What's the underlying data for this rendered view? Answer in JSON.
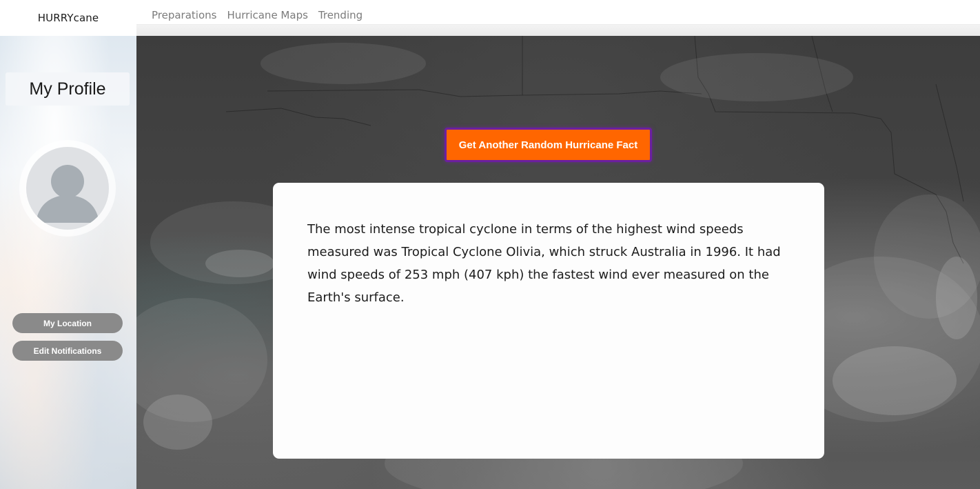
{
  "brand": {
    "name": "HURRYcane"
  },
  "nav": {
    "links": [
      {
        "label": "Preparations"
      },
      {
        "label": "Hurricane Maps"
      },
      {
        "label": "Trending"
      }
    ]
  },
  "sidebar": {
    "profile_title": "My Profile",
    "avatar_icon": "user-avatar-placeholder-icon",
    "buttons": {
      "location_label": "My Location",
      "notifications_label": "Edit Notifications"
    }
  },
  "main": {
    "background": "satellite-hurricane-imagery",
    "fact_button_label": "Get Another Random Hurricane Fact",
    "fact_text": "The most intense tropical cyclone in terms of the highest wind speeds measured was Tropical Cyclone Olivia, which struck Australia in 1996. It had wind speeds of 253 mph (407 kph) the fastest wind ever measured on the Earth's surface."
  },
  "colors": {
    "accent_orange": "#ff6600",
    "button_border_purple": "#6b1fa0",
    "sidebar_button_gray": "#8a8a8a",
    "nav_text_gray": "#7b7b7b"
  }
}
